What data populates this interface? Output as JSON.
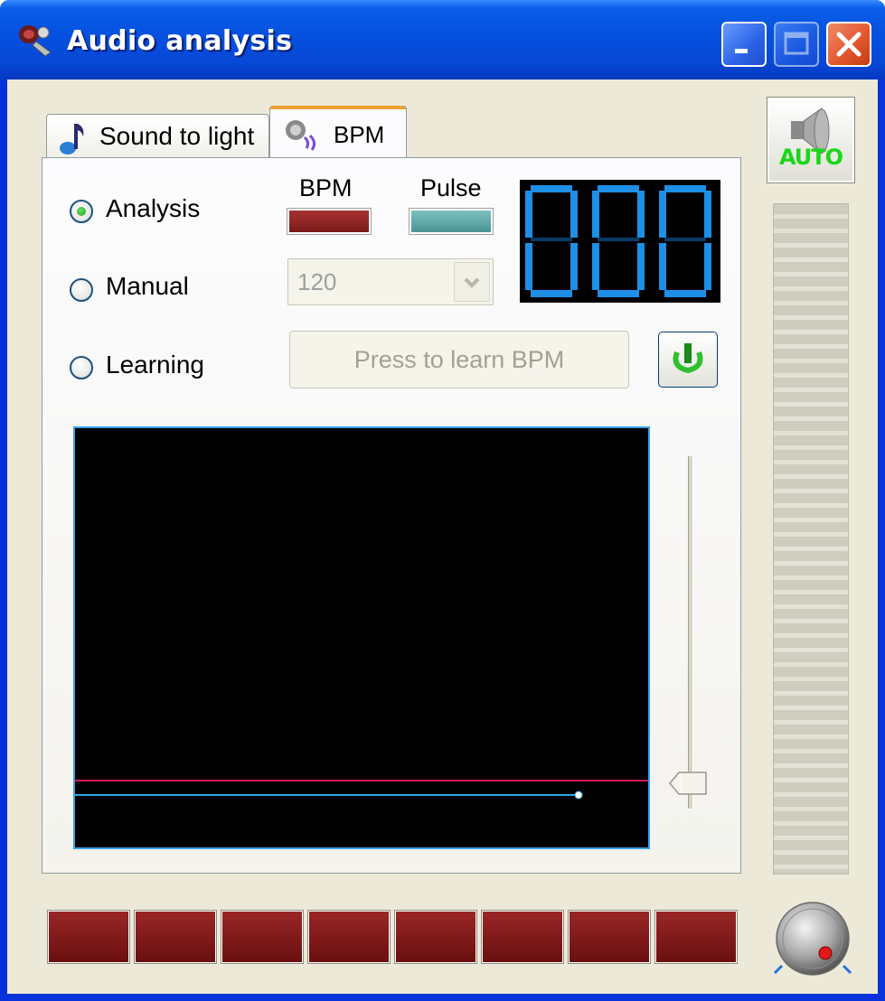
{
  "window": {
    "title": "Audio analysis",
    "accent_color": "#0a5ee8",
    "controls": [
      "minimize-icon",
      "maximize-icon",
      "close-icon"
    ]
  },
  "tabs": [
    {
      "label": "Sound to light",
      "icon": "music-note-icon",
      "active": false
    },
    {
      "label": "BPM",
      "icon": "speaker-sound-icon",
      "active": true
    }
  ],
  "bpm_panel": {
    "modes": [
      {
        "label": "Analysis",
        "selected": true
      },
      {
        "label": "Manual",
        "selected": false
      },
      {
        "label": "Learning",
        "selected": false
      }
    ],
    "bpm_indicator_label": "BPM",
    "pulse_indicator_label": "Pulse",
    "bpm_indicator_color": "#8b2424",
    "pulse_indicator_color": "#5aa5a5",
    "display_value": "000",
    "display_color": "#1e8fe6",
    "manual_bpm_value": "120",
    "learn_button_label": "Press to learn BPM",
    "power_icon": "power-icon",
    "scope": {
      "threshold_color": "#d8185a",
      "signal_color": "#2aa8e8"
    }
  },
  "side": {
    "auto_label": "AUTO",
    "auto_icon": "speaker-icon",
    "knob_icon": "knob-icon"
  },
  "bottom_bar": {
    "cell_count": 8,
    "cell_color": "#7a1818"
  }
}
